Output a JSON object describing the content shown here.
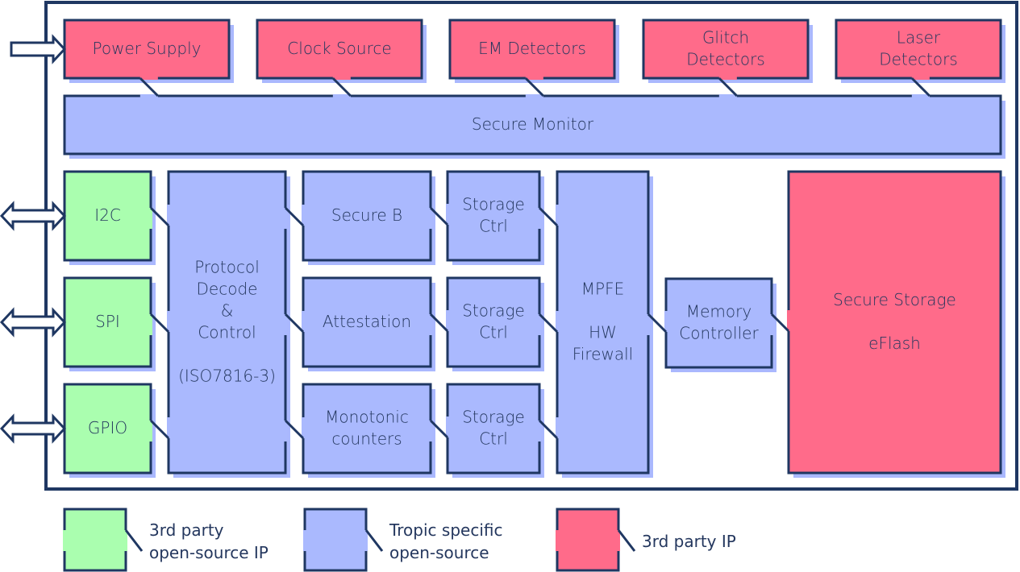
{
  "colors": {
    "border": "#1f3762",
    "shadow": "#aab8fe",
    "third_party_open_source": "#aafeaf",
    "tropic_specific": "#aab9fe",
    "third_party_ip": "#ff6b8a",
    "text": "#24375e",
    "background": "#ffffff"
  },
  "blocks": {
    "power_supply": {
      "lines": [
        "Power Supply"
      ],
      "category": "third_party_ip"
    },
    "clock_source": {
      "lines": [
        "Clock Source"
      ],
      "category": "third_party_ip"
    },
    "em_detectors": {
      "lines": [
        "EM Detectors"
      ],
      "category": "third_party_ip"
    },
    "glitch_detectors": {
      "lines": [
        "Glitch",
        "Detectors"
      ],
      "category": "third_party_ip"
    },
    "laser_detectors": {
      "lines": [
        "Laser",
        "Detectors"
      ],
      "category": "third_party_ip"
    },
    "secure_monitor": {
      "lines": [
        "Secure Monitor"
      ],
      "category": "tropic_specific"
    },
    "i2c": {
      "lines": [
        "I2C"
      ],
      "category": "third_party_open_source"
    },
    "spi": {
      "lines": [
        "SPI"
      ],
      "category": "third_party_open_source"
    },
    "gpio": {
      "lines": [
        "GPIO"
      ],
      "category": "third_party_open_source"
    },
    "protocol_decode": {
      "lines": [
        "Protocol",
        "Decode",
        "&",
        "Control",
        "",
        "(ISO7816-3)"
      ],
      "category": "tropic_specific"
    },
    "secure_b": {
      "lines": [
        "Secure B"
      ],
      "category": "tropic_specific"
    },
    "attestation": {
      "lines": [
        "Attestation"
      ],
      "category": "tropic_specific"
    },
    "monotonic_counters": {
      "lines": [
        "Monotonic",
        "counters"
      ],
      "category": "tropic_specific"
    },
    "storage_ctrl_1": {
      "lines": [
        "Storage",
        "Ctrl"
      ],
      "category": "tropic_specific"
    },
    "storage_ctrl_2": {
      "lines": [
        "Storage",
        "Ctrl"
      ],
      "category": "tropic_specific"
    },
    "storage_ctrl_3": {
      "lines": [
        "Storage",
        "Ctrl"
      ],
      "category": "tropic_specific"
    },
    "mpfe": {
      "lines": [
        "MPFE",
        "",
        "HW",
        "Firewall"
      ],
      "category": "tropic_specific"
    },
    "memory_controller": {
      "lines": [
        "Memory",
        "Controller"
      ],
      "category": "tropic_specific"
    },
    "secure_storage": {
      "lines": [
        "Secure Storage",
        "",
        "eFlash"
      ],
      "category": "third_party_ip"
    }
  },
  "external_arrows": [
    {
      "target": "power_supply",
      "type": "input-arrow"
    },
    {
      "target": "i2c",
      "type": "bidirectional-arrow"
    },
    {
      "target": "spi",
      "type": "bidirectional-arrow"
    },
    {
      "target": "gpio",
      "type": "bidirectional-arrow"
    }
  ],
  "legend": [
    {
      "category": "third_party_open_source",
      "lines": [
        "3rd party",
        "open-source IP"
      ]
    },
    {
      "category": "tropic_specific",
      "lines": [
        "Tropic specific",
        "open-source"
      ]
    },
    {
      "category": "third_party_ip",
      "lines": [
        "3rd party IP"
      ]
    }
  ]
}
